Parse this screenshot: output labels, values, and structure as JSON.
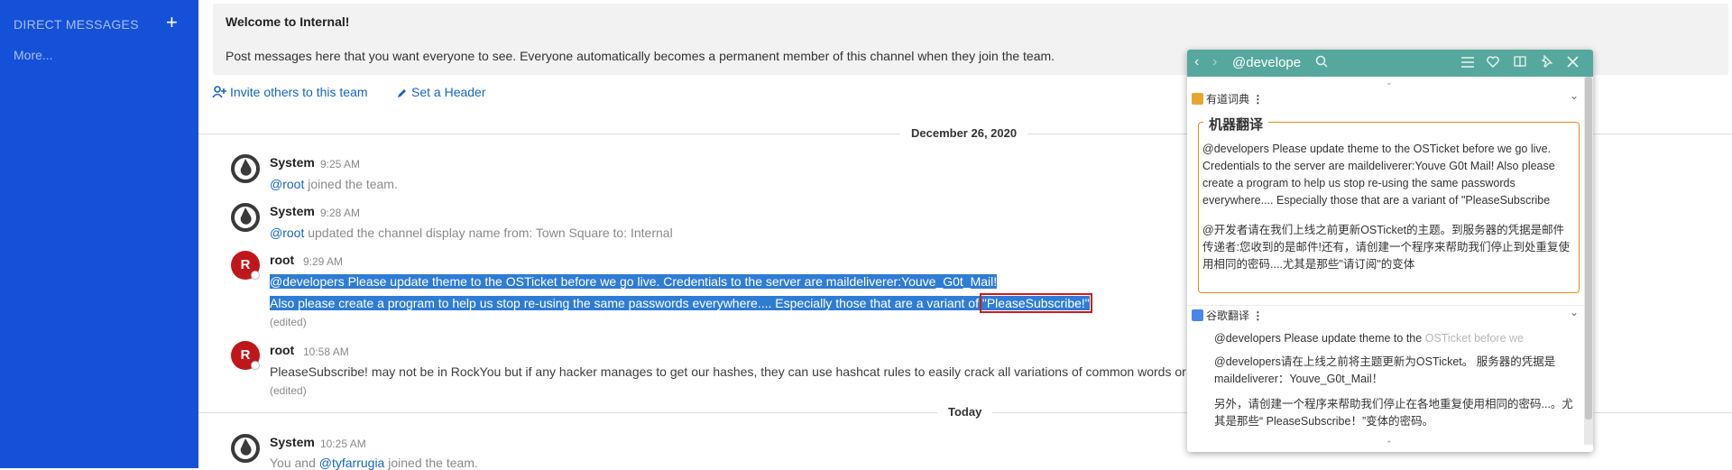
{
  "sidebar": {
    "dm_header": "DIRECT MESSAGES",
    "dm_add": "+",
    "more": "More..."
  },
  "channel_intro": {
    "title": "Welcome to Internal!",
    "text": "Post messages here that you want everyone to see. Everyone automatically becomes a permanent member of this channel when they join the team.",
    "invite_link": "Invite others to this team",
    "header_link": "Set a Header"
  },
  "date_separators": [
    "December 26, 2020",
    "Today"
  ],
  "posts": [
    {
      "author": "System",
      "time": "9:25 AM",
      "mention": "@root",
      "text": " joined the team."
    },
    {
      "author": "System",
      "time": "9:28 AM",
      "mention": "@root",
      "text": " updated the channel display name from: Town Square to: Internal"
    },
    {
      "author": "root",
      "avatar": "R",
      "time": "9:29 AM",
      "line1": "@developers Please update theme to the OSTicket before we go live.  Credentials to the server are maildeliverer:Youve_G0t_Mail!",
      "line2a": "Also please create a program to help us stop re-using the same passwords everywhere.... Especially those that are a variant of ",
      "line2b": "\"PleaseSubscribe!\"",
      "edited": "(edited)"
    },
    {
      "author": "root",
      "avatar": "R",
      "time": "10:58 AM",
      "text": "PleaseSubscribe! may not be in RockYou but if any hacker manages to get our hashes, they can use hashcat rules to easily crack all variations of common words or",
      "edited": "(edited)"
    },
    {
      "author": "System",
      "time": "10:25 AM",
      "text_a": "You and ",
      "mention": "@tyfarrugia",
      "text_b": " joined the team."
    }
  ],
  "popup": {
    "query": "@develope",
    "youdao": {
      "title": "有道词典",
      "legend": "机器翻译",
      "source": "@developers Please update theme to the OSTicket before we go live. Credentials to the server are maildeliverer:Youve G0t Mail! Also please create a program to help us stop re-using the same passwords everywhere.... Especially those that are a variant of \"PleaseSubscribe",
      "translation": "@开发者请在我们上线之前更新OSTicket的主题。到服务器的凭据是邮件传递者:您收到的是邮件!还有，请创建一个程序来帮助我们停止到处重复使用相同的密码....尤其是那些\"请订阅\"的变体"
    },
    "google": {
      "title": "谷歌翻译",
      "source_a": "@developers Please update theme to the ",
      "source_b": "OSTicket before we",
      "translation1": "@developers请在上线之前将主题更新为OSTicket。 服务器的凭据是maildeliverer：Youve_G0t_Mail！",
      "translation2": "另外，请创建一个程序来帮助我们停止在各地重复使用相同的密码...。尤其是那些“ PleaseSubscribe！”变体的密码。"
    },
    "colors": {
      "bar": "#56a89e",
      "fieldset_border": "#e8891a"
    }
  },
  "colors": {
    "sidebar": "#1550d8",
    "link": "#1565c0",
    "selection": "#2f7cd6",
    "avatar_root": "#c0161b"
  }
}
